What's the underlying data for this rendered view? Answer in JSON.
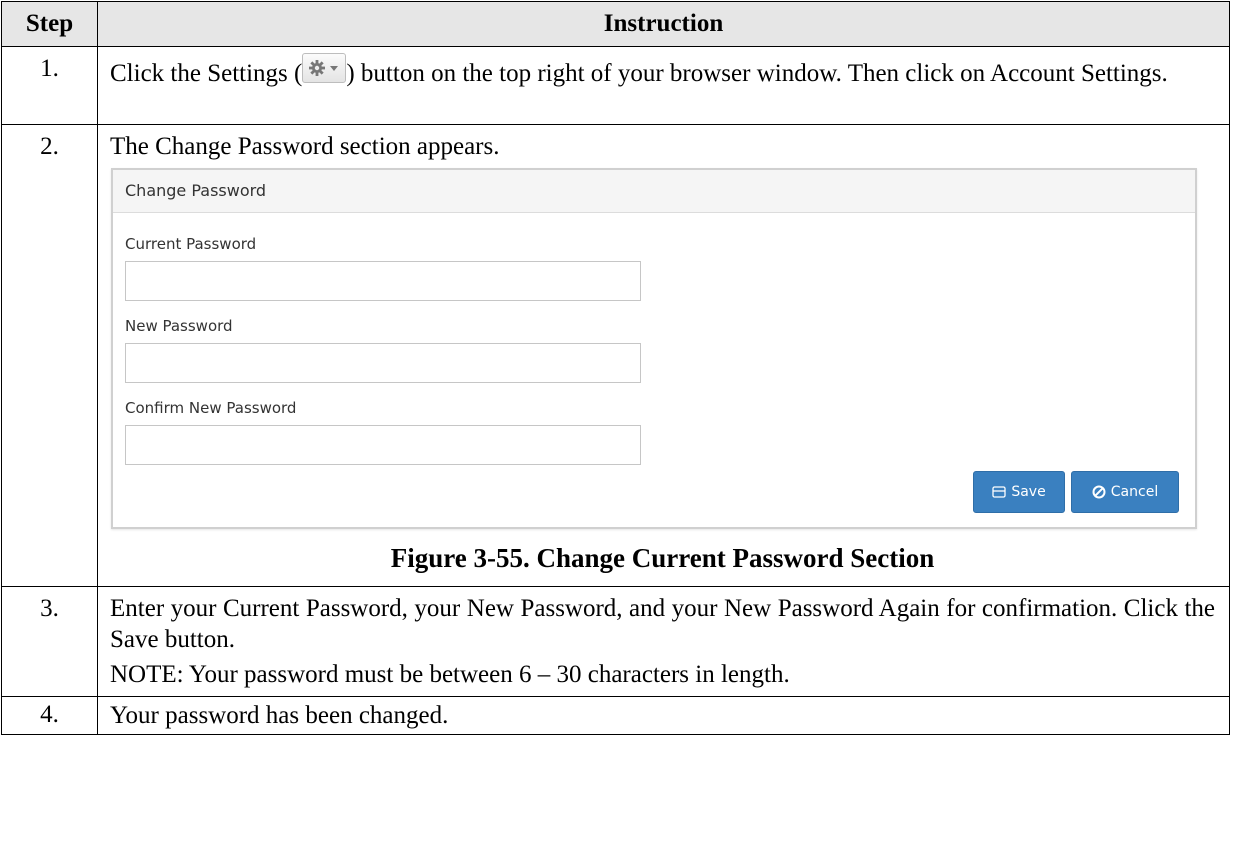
{
  "table": {
    "header_step": "Step",
    "header_instruction": "Instruction"
  },
  "rows": [
    {
      "num": "1.",
      "text_before": "Click the Settings (",
      "text_after": ") button on the top right of your browser window. Then click on Account Settings."
    },
    {
      "num": "2.",
      "text": "The Change Password section appears."
    },
    {
      "num": "3.",
      "text": "Enter your Current Password, your New Password, and your New Password Again for confirmation.  Click the Save button.",
      "note": "NOTE:  Your password must be between 6 – 30 characters in length."
    },
    {
      "num": "4.",
      "text": "Your password has been changed."
    }
  ],
  "figure": {
    "panel_title": "Change Password",
    "current_password_label": "Current Password",
    "current_password_value": "",
    "new_password_label": "New Password",
    "new_password_value": "",
    "confirm_password_label": "Confirm New Password",
    "confirm_password_value": "",
    "save_label": "Save",
    "cancel_label": "Cancel",
    "caption": "Figure 3-55.  Change Current Password Section",
    "button_color": "#3a80c0",
    "icons": {
      "settings": "gear-dropdown-icon",
      "save": "save-icon",
      "cancel": "ban-icon"
    }
  }
}
